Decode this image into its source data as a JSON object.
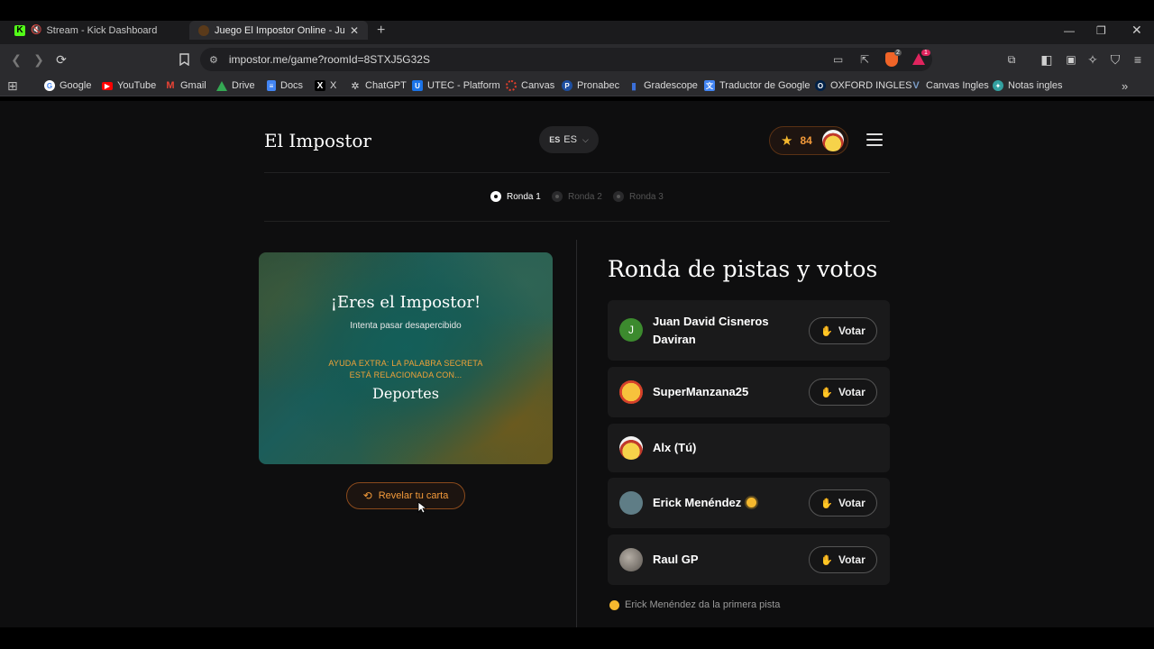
{
  "browser": {
    "tabs": [
      {
        "title": "Stream - Kick Dashboard",
        "icon": "kick-icon"
      },
      {
        "title": "Juego El Impostor Online - Jugar",
        "icon": "impostor-icon"
      }
    ],
    "url": "impostor.me/game?roomId=8STXJ5G32S",
    "bookmarks": [
      {
        "label": "Google",
        "color": "#ffffff"
      },
      {
        "label": "YouTube",
        "color": "#ff0000"
      },
      {
        "label": "Gmail",
        "color": "#ea4335"
      },
      {
        "label": "Drive",
        "color": "#34a853"
      },
      {
        "label": "Docs",
        "color": "#4285f4"
      },
      {
        "label": "X",
        "color": "#000000"
      },
      {
        "label": "ChatGPT",
        "color": "#444444"
      },
      {
        "label": "UTEC - Platform",
        "color": "#1a73e8"
      },
      {
        "label": "Canvas",
        "color": "#e13f2b"
      },
      {
        "label": "Pronabec",
        "color": "#1d4ea0"
      },
      {
        "label": "Gradescope",
        "color": "#3b6fd8"
      },
      {
        "label": "Traductor de Google",
        "color": "#4285f4"
      },
      {
        "label": "OXFORD INGLES",
        "color": "#002147"
      },
      {
        "label": "Canvas Ingles",
        "color": "#7a9cc6"
      },
      {
        "label": "Notas ingles",
        "color": "#33a0a0"
      }
    ],
    "brave_badge": "2",
    "rewards_badge": "1"
  },
  "header": {
    "brand": "El Impostor",
    "lang_flag": "ES",
    "lang_label": "ES",
    "points": "84"
  },
  "rounds": [
    {
      "label": "Ronda 1",
      "active": true
    },
    {
      "label": "Ronda 2",
      "active": false
    },
    {
      "label": "Ronda 3",
      "active": false
    }
  ],
  "card": {
    "title": "¡Eres el Impostor!",
    "subtitle": "Intenta pasar desapercibido",
    "help_line1": "AYUDA EXTRA: LA PALABRA SECRETA",
    "help_line2": "ESTÁ RELACIONADA CON...",
    "word": "Deportes"
  },
  "reveal_button": "Revelar tu carta",
  "panel": {
    "title": "Ronda de pistas y votos",
    "vote_label": "Votar",
    "players": [
      {
        "name_line1": "Juan David Cisneros",
        "name_line2": "Daviran",
        "avatar_letter": "J",
        "avatar_color": "#3c8a2e"
      },
      {
        "name_line1": "SuperManzana25",
        "avatar_color": "#f5b82e"
      },
      {
        "name_line1": "Alx (Tú)",
        "avatar_color": "#f6d24a"
      },
      {
        "name_line1": "Erick Menéndez",
        "avatar_color": "#5f7d86"
      },
      {
        "name_line1": "Raul GP",
        "avatar_color": "#8a8580"
      }
    ],
    "hint": "Erick Menéndez da la primera pista"
  }
}
